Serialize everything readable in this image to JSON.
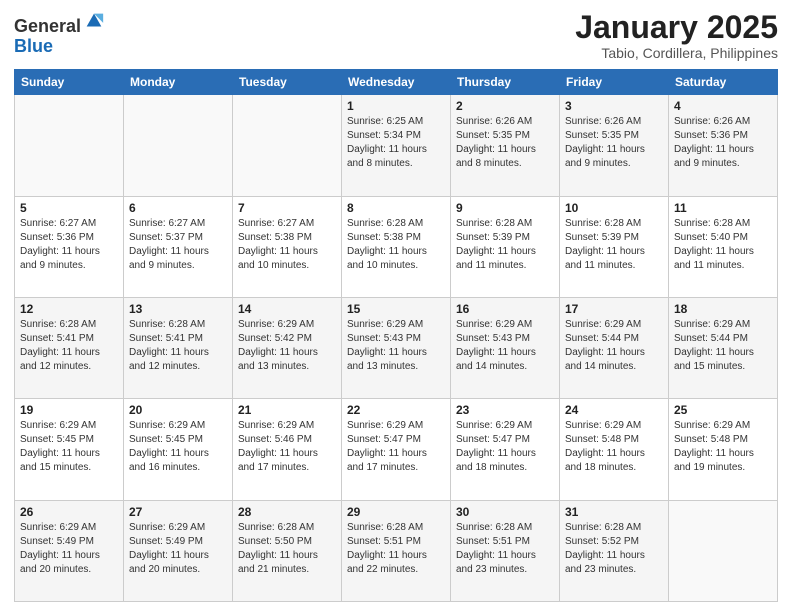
{
  "header": {
    "logo_general": "General",
    "logo_blue": "Blue",
    "month": "January 2025",
    "location": "Tabio, Cordillera, Philippines"
  },
  "days_of_week": [
    "Sunday",
    "Monday",
    "Tuesday",
    "Wednesday",
    "Thursday",
    "Friday",
    "Saturday"
  ],
  "weeks": [
    [
      {
        "day": "",
        "info": ""
      },
      {
        "day": "",
        "info": ""
      },
      {
        "day": "",
        "info": ""
      },
      {
        "day": "1",
        "info": "Sunrise: 6:25 AM\nSunset: 5:34 PM\nDaylight: 11 hours and 8 minutes."
      },
      {
        "day": "2",
        "info": "Sunrise: 6:26 AM\nSunset: 5:35 PM\nDaylight: 11 hours and 8 minutes."
      },
      {
        "day": "3",
        "info": "Sunrise: 6:26 AM\nSunset: 5:35 PM\nDaylight: 11 hours and 9 minutes."
      },
      {
        "day": "4",
        "info": "Sunrise: 6:26 AM\nSunset: 5:36 PM\nDaylight: 11 hours and 9 minutes."
      }
    ],
    [
      {
        "day": "5",
        "info": "Sunrise: 6:27 AM\nSunset: 5:36 PM\nDaylight: 11 hours and 9 minutes."
      },
      {
        "day": "6",
        "info": "Sunrise: 6:27 AM\nSunset: 5:37 PM\nDaylight: 11 hours and 9 minutes."
      },
      {
        "day": "7",
        "info": "Sunrise: 6:27 AM\nSunset: 5:38 PM\nDaylight: 11 hours and 10 minutes."
      },
      {
        "day": "8",
        "info": "Sunrise: 6:28 AM\nSunset: 5:38 PM\nDaylight: 11 hours and 10 minutes."
      },
      {
        "day": "9",
        "info": "Sunrise: 6:28 AM\nSunset: 5:39 PM\nDaylight: 11 hours and 11 minutes."
      },
      {
        "day": "10",
        "info": "Sunrise: 6:28 AM\nSunset: 5:39 PM\nDaylight: 11 hours and 11 minutes."
      },
      {
        "day": "11",
        "info": "Sunrise: 6:28 AM\nSunset: 5:40 PM\nDaylight: 11 hours and 11 minutes."
      }
    ],
    [
      {
        "day": "12",
        "info": "Sunrise: 6:28 AM\nSunset: 5:41 PM\nDaylight: 11 hours and 12 minutes."
      },
      {
        "day": "13",
        "info": "Sunrise: 6:28 AM\nSunset: 5:41 PM\nDaylight: 11 hours and 12 minutes."
      },
      {
        "day": "14",
        "info": "Sunrise: 6:29 AM\nSunset: 5:42 PM\nDaylight: 11 hours and 13 minutes."
      },
      {
        "day": "15",
        "info": "Sunrise: 6:29 AM\nSunset: 5:43 PM\nDaylight: 11 hours and 13 minutes."
      },
      {
        "day": "16",
        "info": "Sunrise: 6:29 AM\nSunset: 5:43 PM\nDaylight: 11 hours and 14 minutes."
      },
      {
        "day": "17",
        "info": "Sunrise: 6:29 AM\nSunset: 5:44 PM\nDaylight: 11 hours and 14 minutes."
      },
      {
        "day": "18",
        "info": "Sunrise: 6:29 AM\nSunset: 5:44 PM\nDaylight: 11 hours and 15 minutes."
      }
    ],
    [
      {
        "day": "19",
        "info": "Sunrise: 6:29 AM\nSunset: 5:45 PM\nDaylight: 11 hours and 15 minutes."
      },
      {
        "day": "20",
        "info": "Sunrise: 6:29 AM\nSunset: 5:45 PM\nDaylight: 11 hours and 16 minutes."
      },
      {
        "day": "21",
        "info": "Sunrise: 6:29 AM\nSunset: 5:46 PM\nDaylight: 11 hours and 17 minutes."
      },
      {
        "day": "22",
        "info": "Sunrise: 6:29 AM\nSunset: 5:47 PM\nDaylight: 11 hours and 17 minutes."
      },
      {
        "day": "23",
        "info": "Sunrise: 6:29 AM\nSunset: 5:47 PM\nDaylight: 11 hours and 18 minutes."
      },
      {
        "day": "24",
        "info": "Sunrise: 6:29 AM\nSunset: 5:48 PM\nDaylight: 11 hours and 18 minutes."
      },
      {
        "day": "25",
        "info": "Sunrise: 6:29 AM\nSunset: 5:48 PM\nDaylight: 11 hours and 19 minutes."
      }
    ],
    [
      {
        "day": "26",
        "info": "Sunrise: 6:29 AM\nSunset: 5:49 PM\nDaylight: 11 hours and 20 minutes."
      },
      {
        "day": "27",
        "info": "Sunrise: 6:29 AM\nSunset: 5:49 PM\nDaylight: 11 hours and 20 minutes."
      },
      {
        "day": "28",
        "info": "Sunrise: 6:28 AM\nSunset: 5:50 PM\nDaylight: 11 hours and 21 minutes."
      },
      {
        "day": "29",
        "info": "Sunrise: 6:28 AM\nSunset: 5:51 PM\nDaylight: 11 hours and 22 minutes."
      },
      {
        "day": "30",
        "info": "Sunrise: 6:28 AM\nSunset: 5:51 PM\nDaylight: 11 hours and 23 minutes."
      },
      {
        "day": "31",
        "info": "Sunrise: 6:28 AM\nSunset: 5:52 PM\nDaylight: 11 hours and 23 minutes."
      },
      {
        "day": "",
        "info": ""
      }
    ]
  ]
}
